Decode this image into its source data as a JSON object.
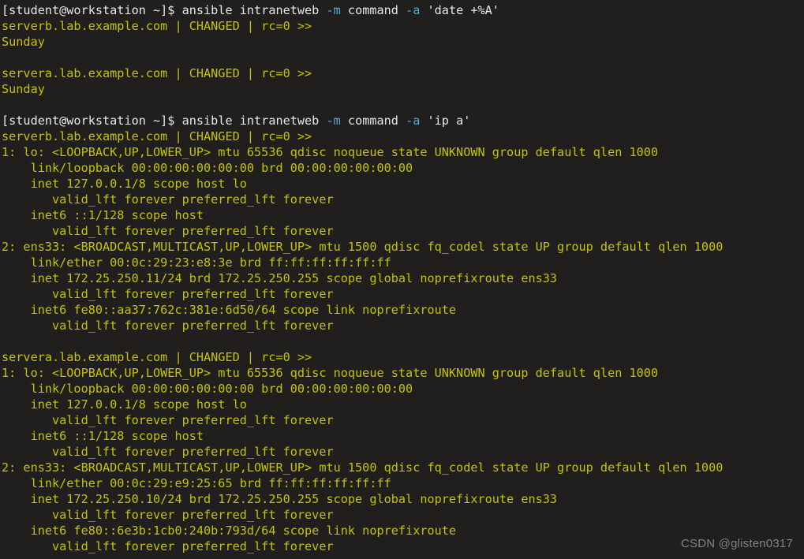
{
  "terminal": {
    "background_color": "#211f1e",
    "prompt_color": "#e8e8e8",
    "output_color": "#c5c400",
    "flag_color": "#55a8d8",
    "watermark": "CSDN @glisten0317",
    "prompt": "[student@workstation ~]$",
    "lines": [
      {
        "type": "command",
        "prompt": "[student@workstation ~]$",
        "parts": [
          {
            "text": " ansible intranetweb ",
            "color": "cmd"
          },
          {
            "text": "-m",
            "color": "flag"
          },
          {
            "text": " command ",
            "color": "cmd"
          },
          {
            "text": "-a",
            "color": "flag"
          },
          {
            "text": " 'date +%A'",
            "color": "cmd"
          }
        ]
      },
      {
        "type": "output",
        "text": "serverb.lab.example.com | CHANGED | rc=0 >>"
      },
      {
        "type": "output",
        "text": "Sunday"
      },
      {
        "type": "blank",
        "text": ""
      },
      {
        "type": "output",
        "text": "servera.lab.example.com | CHANGED | rc=0 >>"
      },
      {
        "type": "output",
        "text": "Sunday"
      },
      {
        "type": "blank",
        "text": ""
      },
      {
        "type": "command",
        "prompt": "[student@workstation ~]$",
        "parts": [
          {
            "text": " ansible intranetweb ",
            "color": "cmd"
          },
          {
            "text": "-m",
            "color": "flag"
          },
          {
            "text": " command ",
            "color": "cmd"
          },
          {
            "text": "-a",
            "color": "flag"
          },
          {
            "text": " 'ip a'",
            "color": "cmd"
          }
        ]
      },
      {
        "type": "output",
        "text": "serverb.lab.example.com | CHANGED | rc=0 >>"
      },
      {
        "type": "output",
        "text": "1: lo: <LOOPBACK,UP,LOWER_UP> mtu 65536 qdisc noqueue state UNKNOWN group default qlen 1000"
      },
      {
        "type": "output",
        "text": "    link/loopback 00:00:00:00:00:00 brd 00:00:00:00:00:00"
      },
      {
        "type": "output",
        "text": "    inet 127.0.0.1/8 scope host lo"
      },
      {
        "type": "output",
        "text": "       valid_lft forever preferred_lft forever"
      },
      {
        "type": "output",
        "text": "    inet6 ::1/128 scope host"
      },
      {
        "type": "output",
        "text": "       valid_lft forever preferred_lft forever"
      },
      {
        "type": "output",
        "text": "2: ens33: <BROADCAST,MULTICAST,UP,LOWER_UP> mtu 1500 qdisc fq_codel state UP group default qlen 1000"
      },
      {
        "type": "output",
        "text": "    link/ether 00:0c:29:23:e8:3e brd ff:ff:ff:ff:ff:ff"
      },
      {
        "type": "output",
        "text": "    inet 172.25.250.11/24 brd 172.25.250.255 scope global noprefixroute ens33"
      },
      {
        "type": "output",
        "text": "       valid_lft forever preferred_lft forever"
      },
      {
        "type": "output",
        "text": "    inet6 fe80::aa37:762c:381e:6d50/64 scope link noprefixroute"
      },
      {
        "type": "output",
        "text": "       valid_lft forever preferred_lft forever"
      },
      {
        "type": "blank",
        "text": ""
      },
      {
        "type": "output",
        "text": "servera.lab.example.com | CHANGED | rc=0 >>"
      },
      {
        "type": "output",
        "text": "1: lo: <LOOPBACK,UP,LOWER_UP> mtu 65536 qdisc noqueue state UNKNOWN group default qlen 1000"
      },
      {
        "type": "output",
        "text": "    link/loopback 00:00:00:00:00:00 brd 00:00:00:00:00:00"
      },
      {
        "type": "output",
        "text": "    inet 127.0.0.1/8 scope host lo"
      },
      {
        "type": "output",
        "text": "       valid_lft forever preferred_lft forever"
      },
      {
        "type": "output",
        "text": "    inet6 ::1/128 scope host"
      },
      {
        "type": "output",
        "text": "       valid_lft forever preferred_lft forever"
      },
      {
        "type": "output",
        "text": "2: ens33: <BROADCAST,MULTICAST,UP,LOWER_UP> mtu 1500 qdisc fq_codel state UP group default qlen 1000"
      },
      {
        "type": "output",
        "text": "    link/ether 00:0c:29:e9:25:65 brd ff:ff:ff:ff:ff:ff"
      },
      {
        "type": "output",
        "text": "    inet 172.25.250.10/24 brd 172.25.250.255 scope global noprefixroute ens33"
      },
      {
        "type": "output",
        "text": "       valid_lft forever preferred_lft forever"
      },
      {
        "type": "output",
        "text": "    inet6 fe80::6e3b:1cb0:240b:793d/64 scope link noprefixroute"
      },
      {
        "type": "output",
        "text": "       valid_lft forever preferred_lft forever"
      }
    ]
  }
}
